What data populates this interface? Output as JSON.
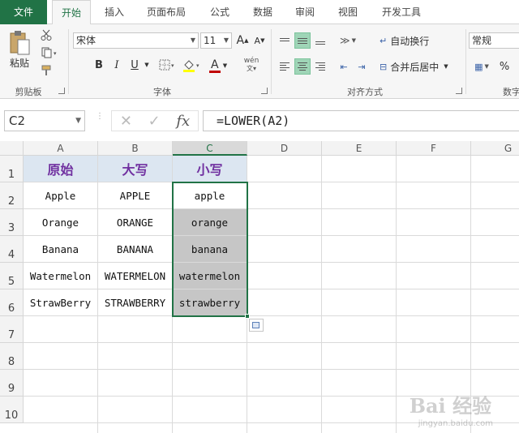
{
  "tabs": [
    "文件",
    "开始",
    "插入",
    "页面布局",
    "公式",
    "数据",
    "审阅",
    "视图",
    "开发工具"
  ],
  "ribbon": {
    "clipboard": {
      "paste_label": "粘贴",
      "group_label": "剪贴板"
    },
    "font": {
      "font_name": "宋体",
      "font_size": "11",
      "bold": "B",
      "italic": "I",
      "underline": "U",
      "grow": "A",
      "shrink": "A",
      "font_color": "A",
      "phonetic": "wén",
      "group_label": "字体"
    },
    "alignment": {
      "wrap_text": "自动换行",
      "merge_center": "合并后居中",
      "group_label": "对齐方式"
    },
    "number": {
      "format": "常规",
      "percent": "%",
      "group_label": "数字"
    }
  },
  "formula_bar": {
    "name_box": "C2",
    "cancel": "✕",
    "enter": "✓",
    "fx": "fx",
    "formula": "=LOWER(A2)"
  },
  "sheet": {
    "columns": [
      "A",
      "B",
      "C",
      "D",
      "E",
      "F",
      "G"
    ],
    "rows": [
      "1",
      "2",
      "3",
      "4",
      "5",
      "6",
      "7",
      "8",
      "9",
      "10"
    ],
    "header_row": [
      "原始",
      "大写",
      "小写"
    ],
    "data": [
      [
        "Apple",
        "APPLE",
        "apple"
      ],
      [
        "Orange",
        "ORANGE",
        "orange"
      ],
      [
        "Banana",
        "BANANA",
        "banana"
      ],
      [
        "Watermelon",
        "WATERMELON",
        "watermelon"
      ],
      [
        "StrawBerry",
        "STRAWBERRY",
        "strawberry"
      ]
    ],
    "selected_column": "C",
    "header_text_color": "#7030a0",
    "header_fill": "#dce6f1",
    "selection_color": "#217346"
  },
  "watermark": {
    "logo": "Bai 经验",
    "url": "jingyan.baidu.com"
  }
}
